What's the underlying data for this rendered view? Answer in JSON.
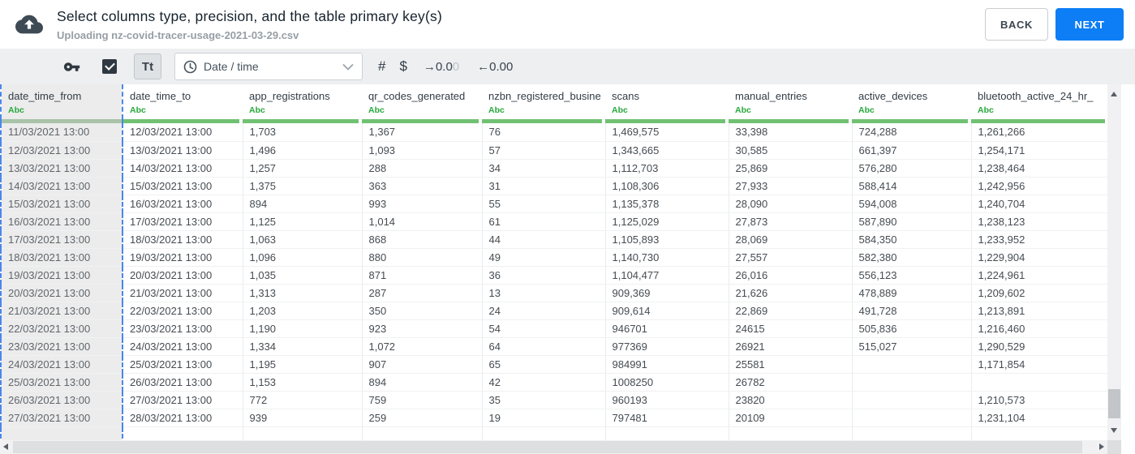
{
  "header": {
    "title": "Select columns type, precision, and the table primary key(s)",
    "subtitle": "Uploading nz-covid-tracer-usage-2021-03-29.csv",
    "back_button": "BACK",
    "next_button": "NEXT"
  },
  "toolbar": {
    "checkbox_checked": true,
    "text_type_label": "Tt",
    "type_dropdown_value": "Date / time",
    "number_symbol": "#",
    "currency_symbol": "$",
    "decimals_right_main": "→0.0",
    "decimals_right_faded": "0",
    "decimals_left_label": "←0.00"
  },
  "colors": {
    "accent_blue": "#0d7ef5",
    "type_green": "#27a83c",
    "column_bar_green": "#71c173",
    "selected_column_dash_blue": "#4a86ee",
    "toolbar_gray": "#edeff1"
  },
  "table": {
    "type_label": "Abc",
    "columns": [
      {
        "name": "date_time_from",
        "selected": true
      },
      {
        "name": "date_time_to",
        "selected": false
      },
      {
        "name": "app_registrations",
        "selected": false
      },
      {
        "name": "qr_codes_generated",
        "selected": false
      },
      {
        "name": "nzbn_registered_busine",
        "selected": false
      },
      {
        "name": "scans",
        "selected": false
      },
      {
        "name": "manual_entries",
        "selected": false
      },
      {
        "name": "active_devices",
        "selected": false
      },
      {
        "name": "bluetooth_active_24_hr_",
        "selected": false
      }
    ],
    "rows": [
      [
        "11/03/2021 13:00",
        "12/03/2021 13:00",
        "1,703",
        "1,367",
        "76",
        "1,469,575",
        "33,398",
        "724,288",
        "1,261,266"
      ],
      [
        "12/03/2021 13:00",
        "13/03/2021 13:00",
        "1,496",
        "1,093",
        "57",
        "1,343,665",
        "30,585",
        "661,397",
        "1,254,171"
      ],
      [
        "13/03/2021 13:00",
        "14/03/2021 13:00",
        "1,257",
        "288",
        "34",
        "1,112,703",
        "25,869",
        "576,280",
        "1,238,464"
      ],
      [
        "14/03/2021 13:00",
        "15/03/2021 13:00",
        "1,375",
        "363",
        "31",
        "1,108,306",
        "27,933",
        "588,414",
        "1,242,956"
      ],
      [
        "15/03/2021 13:00",
        "16/03/2021 13:00",
        "894",
        "993",
        "55",
        "1,135,378",
        "28,090",
        "594,008",
        "1,240,704"
      ],
      [
        "16/03/2021 13:00",
        "17/03/2021 13:00",
        "1,125",
        "1,014",
        "61",
        "1,125,029",
        "27,873",
        "587,890",
        "1,238,123"
      ],
      [
        "17/03/2021 13:00",
        "18/03/2021 13:00",
        "1,063",
        "868",
        "44",
        "1,105,893",
        "28,069",
        "584,350",
        "1,233,952"
      ],
      [
        "18/03/2021 13:00",
        "19/03/2021 13:00",
        "1,096",
        "880",
        "49",
        "1,140,730",
        "27,557",
        "582,380",
        "1,229,904"
      ],
      [
        "19/03/2021 13:00",
        "20/03/2021 13:00",
        "1,035",
        "871",
        "36",
        "1,104,477",
        "26,016",
        "556,123",
        "1,224,961"
      ],
      [
        "20/03/2021 13:00",
        "21/03/2021 13:00",
        "1,313",
        "287",
        "13",
        "909,369",
        "21,626",
        "478,889",
        "1,209,602"
      ],
      [
        "21/03/2021 13:00",
        "22/03/2021 13:00",
        "1,203",
        "350",
        "24",
        "909,614",
        "22,869",
        "491,728",
        "1,213,891"
      ],
      [
        "22/03/2021 13:00",
        "23/03/2021 13:00",
        "1,190",
        "923",
        "54",
        "946701",
        "24615",
        "505,836",
        "1,216,460"
      ],
      [
        "23/03/2021 13:00",
        "24/03/2021 13:00",
        "1,334",
        "1,072",
        "64",
        "977369",
        "26921",
        "515,027",
        "1,290,529"
      ],
      [
        "24/03/2021 13:00",
        "25/03/2021 13:00",
        "1,195",
        "907",
        "65",
        "984991",
        "25581",
        "",
        "1,171,854"
      ],
      [
        "25/03/2021 13:00",
        "26/03/2021 13:00",
        "1,153",
        "894",
        "42",
        "1008250",
        "26782",
        "",
        ""
      ],
      [
        "26/03/2021 13:00",
        "27/03/2021 13:00",
        "772",
        "759",
        "35",
        "960193",
        "23820",
        "",
        "1,210,573"
      ],
      [
        "27/03/2021 13:00",
        "28/03/2021 13:00",
        "939",
        "259",
        "19",
        "797481",
        "20109",
        "",
        "1,231,104"
      ]
    ]
  }
}
